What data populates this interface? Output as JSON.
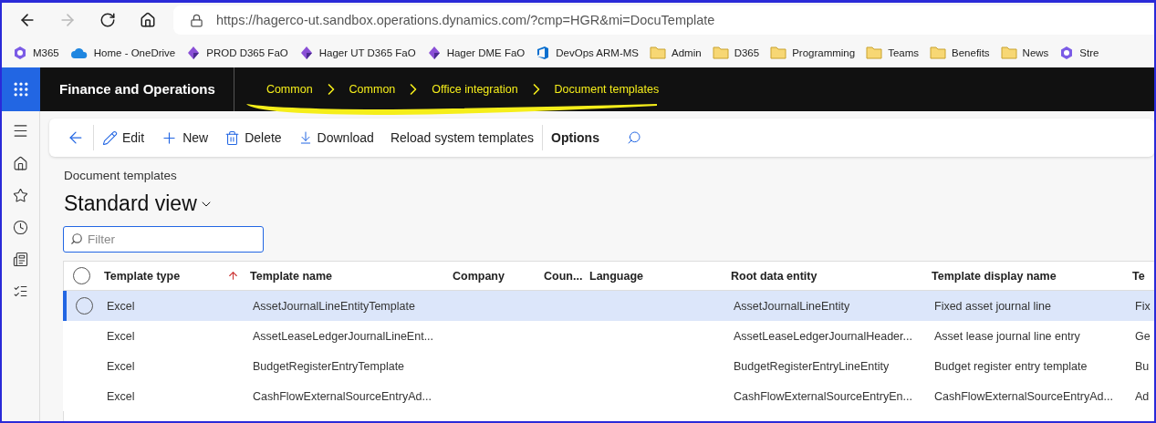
{
  "browser": {
    "url": "https://hagerco-ut.sandbox.operations.dynamics.com/?cmp=HGR&mi=DocuTemplate",
    "bookmarks": [
      {
        "kind": "m365",
        "label": "M365"
      },
      {
        "kind": "cloud",
        "label": "Home - OneDrive"
      },
      {
        "kind": "diamond",
        "label": "PROD D365 FaO"
      },
      {
        "kind": "diamond",
        "label": "Hager UT D365 FaO"
      },
      {
        "kind": "diamond",
        "label": "Hager DME FaO"
      },
      {
        "kind": "devops",
        "label": "DevOps ARM-MS"
      },
      {
        "kind": "folder",
        "label": "Admin"
      },
      {
        "kind": "folder",
        "label": "D365"
      },
      {
        "kind": "folder",
        "label": "Programming"
      },
      {
        "kind": "folder",
        "label": "Teams"
      },
      {
        "kind": "folder",
        "label": "Benefits"
      },
      {
        "kind": "folder",
        "label": "News"
      },
      {
        "kind": "m365",
        "label": "Stre"
      }
    ]
  },
  "app": {
    "title": "Finance and Operations",
    "breadcrumbs": [
      "Common",
      "Common",
      "Office integration",
      "Document templates"
    ],
    "highlighted": true
  },
  "toolbar": [
    {
      "kind": "edit",
      "label": "Edit"
    },
    {
      "kind": "new",
      "label": "New"
    },
    {
      "kind": "delete",
      "label": "Delete"
    },
    {
      "kind": "download",
      "label": "Download"
    },
    {
      "kind": "plain",
      "label": "Reload system templates"
    },
    {
      "kind": "options",
      "label": "Options"
    }
  ],
  "page": {
    "caption": "Document templates",
    "view": "Standard view"
  },
  "filter": {
    "placeholder": "Filter"
  },
  "table": {
    "all_selected": false,
    "columns": [
      "Template type",
      "Template name",
      "Company",
      "Coun...",
      "Language",
      "Root data entity",
      "Template display name",
      "Te"
    ],
    "rows": [
      {
        "selected": true,
        "cells": [
          "Excel",
          "AssetJournalLineEntityTemplate",
          "",
          "",
          "",
          "AssetJournalLineEntity",
          "Fixed asset journal line",
          "Fix"
        ]
      },
      {
        "selected": false,
        "cells": [
          "Excel",
          "AssetLeaseLedgerJournalLineEnt...",
          "",
          "",
          "",
          "AssetLeaseLedgerJournalHeader...",
          "Asset lease journal line entry",
          "Ge"
        ]
      },
      {
        "selected": false,
        "cells": [
          "Excel",
          "BudgetRegisterEntryTemplate",
          "",
          "",
          "",
          "BudgetRegisterEntryLineEntity",
          "Budget register entry template",
          "Bu"
        ]
      },
      {
        "selected": false,
        "cells": [
          "Excel",
          "CashFlowExternalSourceEntryAd...",
          "",
          "",
          "",
          "CashFlowExternalSourceEntryEn...",
          "CashFlowExternalSourceEntryAd...",
          "Ad"
        ]
      }
    ]
  }
}
